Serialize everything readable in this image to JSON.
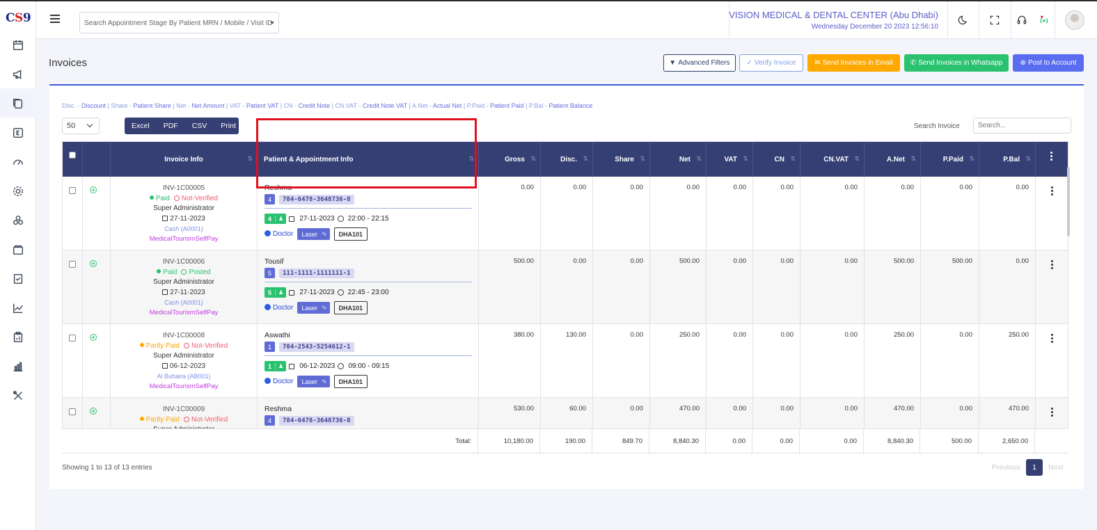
{
  "brand": {
    "c": "C",
    "s": "S",
    "n": "9"
  },
  "header": {
    "search_placeholder": "Search Appointment Stage By Patient MRN / Mobile / Visit ID",
    "clinic": "VISION MEDICAL & DENTAL CENTER (Abu Dhabi)",
    "datetime": "Wednesday December 20 2023 12:56:10"
  },
  "page": {
    "title": "Invoices"
  },
  "actions": {
    "advanced_filters": "Advanced Filters",
    "verify_invoice": "Verify Invoice",
    "send_email": "Send Invoices in Email",
    "send_whatsapp": "Send Invoices in Whatsapp",
    "post_account": "Post to Account"
  },
  "legend": [
    {
      "k": "Disc.",
      "v": "Discount"
    },
    {
      "k": "Share",
      "v": "Patient Share"
    },
    {
      "k": "Net",
      "v": "Net Amount"
    },
    {
      "k": "VAT",
      "v": "Patient VAT"
    },
    {
      "k": "CN",
      "v": "Credit Note"
    },
    {
      "k": "CN.VAT",
      "v": "Credit Note VAT"
    },
    {
      "k": "A.Net",
      "v": "Actual Net"
    },
    {
      "k": "P.Paid",
      "v": "Patient Paid"
    },
    {
      "k": "P.Bal",
      "v": "Patient Balance"
    }
  ],
  "table_controls": {
    "page_length": "50",
    "export": [
      "Excel",
      "PDF",
      "CSV",
      "Print"
    ],
    "search_label": "Search Invoice",
    "search_placeholder": "Search..."
  },
  "columns": [
    "Invoice Info",
    "Patient & Appointment Info",
    "Gross",
    "Disc.",
    "Share",
    "Net",
    "VAT",
    "CN",
    "CN.VAT",
    "A.Net",
    "P.Paid",
    "P.Bal"
  ],
  "rows": [
    {
      "invoice_no": "INV-1C00005",
      "pay_status": "Paid",
      "verify_status": "Not-Verified",
      "user": "Super Administrator",
      "date": "27-11-2023",
      "cash": "Cash (A0001)",
      "payer": "MedicalTourismSelfPay",
      "patient": "Reshma",
      "patient_count": "4",
      "mrn": "784-6478-3648736-8",
      "visit_count": "4",
      "appt_date": "27-11-2023",
      "appt_time": "22:00 - 22:15",
      "doctor": "Doctor",
      "service": "Laser",
      "room": "DHA101",
      "gross": "0.00",
      "disc": "0.00",
      "share": "0.00",
      "net": "0.00",
      "vat": "0.00",
      "cn": "0.00",
      "cnvat": "0.00",
      "anet": "0.00",
      "ppaid": "0.00",
      "pbal": "0.00"
    },
    {
      "invoice_no": "INV-1C00006",
      "pay_status": "Paid",
      "verify_status": "Posted",
      "user": "Super Administrator",
      "date": "27-11-2023",
      "cash": "Cash (A0001)",
      "payer": "MedicalTourismSelfPay",
      "patient": "Tousif",
      "patient_count": "5",
      "mrn": "111-1111-1111111-1",
      "visit_count": "5",
      "appt_date": "27-11-2023",
      "appt_time": "22:45 - 23:00",
      "doctor": "Doctor",
      "service": "Laser",
      "room": "DHA101",
      "gross": "500.00",
      "disc": "0.00",
      "share": "0.00",
      "net": "500.00",
      "vat": "0.00",
      "cn": "0.00",
      "cnvat": "0.00",
      "anet": "500.00",
      "ppaid": "500.00",
      "pbal": "0.00"
    },
    {
      "invoice_no": "INV-1C00008",
      "pay_status": "Partly Paid",
      "verify_status": "Not-Verified",
      "user": "Super Administrator",
      "date": "06-12-2023",
      "cash": "Al Buhaira (AB001)",
      "payer": "MedicalTourismSelfPay",
      "patient": "Aswathi",
      "patient_count": "1",
      "mrn": "784-2543-5254612-1",
      "visit_count": "1",
      "appt_date": "06-12-2023",
      "appt_time": "09:00 - 09:15",
      "doctor": "Doctor",
      "service": "Laser",
      "room": "DHA101",
      "gross": "380.00",
      "disc": "130.00",
      "share": "0.00",
      "net": "250.00",
      "vat": "0.00",
      "cn": "0.00",
      "cnvat": "0.00",
      "anet": "250.00",
      "ppaid": "0.00",
      "pbal": "250.00"
    },
    {
      "invoice_no": "INV-1C00009",
      "pay_status": "Partly Paid",
      "verify_status": "Not-Verified",
      "user": "Super Administrator",
      "patient": "Reshma",
      "patient_count": "4",
      "mrn": "784-6478-3648736-8",
      "gross": "530.00",
      "disc": "60.00",
      "share": "0.00",
      "net": "470.00",
      "vat": "0.00",
      "cn": "0.00",
      "cnvat": "0.00",
      "anet": "470.00",
      "ppaid": "0.00",
      "pbal": "470.00"
    }
  ],
  "totals": {
    "label": "Total:",
    "gross": "10,180.00",
    "disc": "190.00",
    "share": "849.70",
    "net": "8,840.30",
    "vat": "0.00",
    "cn": "0.00",
    "cnvat": "0.00",
    "anet": "8,840.30",
    "ppaid": "500.00",
    "pbal": "2,650.00"
  },
  "pagination": {
    "info": "Showing 1 to 13 of 13 entries",
    "previous": "Previous",
    "page": "1",
    "next": "Next"
  },
  "colors": {
    "header_bg": "#353f74",
    "accent": "#5c5cc8",
    "green": "#2bc26f",
    "orange": "#ffa800",
    "red": "#f25c6c",
    "highlight": "#e0101c"
  }
}
